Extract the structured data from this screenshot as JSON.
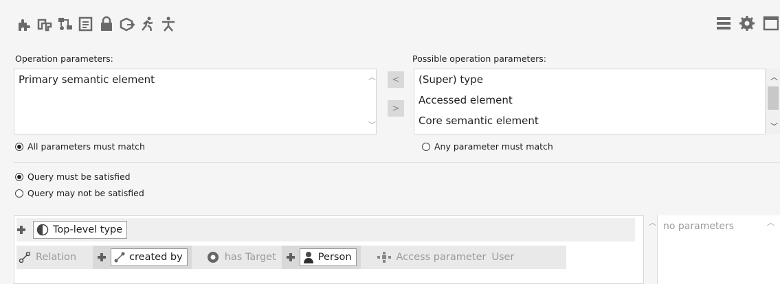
{
  "toolbar": {
    "icons": [
      "puzzle-icon",
      "pattern-icon",
      "network-icon",
      "document-list-icon",
      "lock-icon",
      "cube-export-icon",
      "runner-icon",
      "stick-figure-icon"
    ]
  },
  "topright": {
    "icons": [
      "menu-icon",
      "gear-icon",
      "window-icon"
    ]
  },
  "operation_parameters": {
    "label": "Operation parameters:",
    "items": [
      "Primary semantic element"
    ]
  },
  "possible_parameters": {
    "label": "Possible operation parameters:",
    "items": [
      "(Super) type",
      "Accessed element",
      "Core semantic element"
    ]
  },
  "move_left_label": "<",
  "move_right_label": ">",
  "match_mode": {
    "all_label": "All parameters must match",
    "any_label": "Any parameter must match",
    "selected": "all"
  },
  "query_mode": {
    "must_label": "Query must be satisfied",
    "may_not_label": "Query may not be satisfied",
    "selected": "must"
  },
  "query": {
    "root_type_label": "Top-level type",
    "relation_label": "Relation",
    "relation_value": "created by",
    "has_target_label": "has Target",
    "target_value": "Person",
    "access_parameter_label": "Access parameter",
    "access_parameter_value": "User"
  },
  "parameters_panel": {
    "empty_text": "no parameters"
  },
  "colors": {
    "accent_grey": "#5f5f5f",
    "background": "#f5f5f5"
  }
}
